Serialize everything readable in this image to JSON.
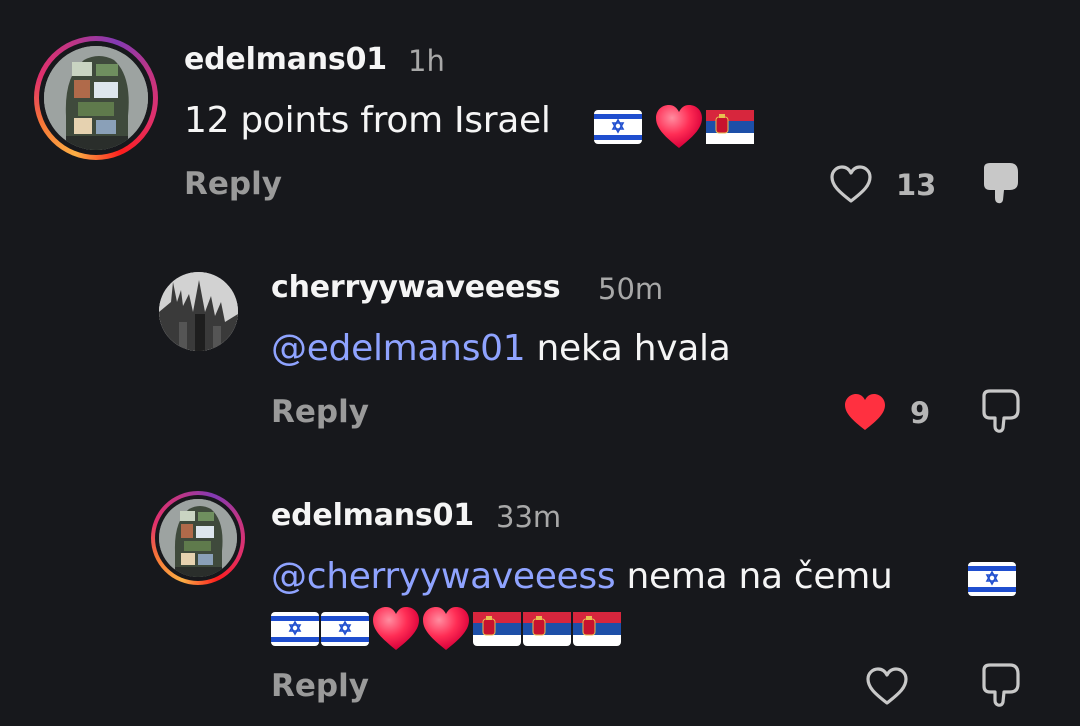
{
  "comments": [
    {
      "username": "edelmans01",
      "time": "1h",
      "text": "12 points from Israel",
      "reply_label": "Reply",
      "like_count": "13",
      "liked": false,
      "story_ring": true,
      "emojis": [
        "israel-flag",
        "red-heart",
        "serbia-flag"
      ]
    },
    {
      "username": "cherryywaveeess",
      "time": "50m",
      "mention": "@edelmans01",
      "text": "neka hvala",
      "reply_label": "Reply",
      "like_count": "9",
      "liked": true,
      "story_ring": false
    },
    {
      "username": "edelmans01",
      "time": "33m",
      "mention": "@cherryywaveeess",
      "text": "nema na čemu",
      "reply_label": "Reply",
      "like_count": "",
      "liked": false,
      "story_ring": true,
      "emojis_line1": [
        "israel-flag"
      ],
      "emojis_line2": [
        "israel-flag",
        "israel-flag",
        "red-heart",
        "red-heart",
        "serbia-flag",
        "serbia-flag",
        "serbia-flag"
      ]
    }
  ],
  "colors": {
    "background": "#17181c",
    "mention": "#8fa3ff",
    "liked_heart": "#ff3040",
    "muted": "#9a9a9a"
  }
}
